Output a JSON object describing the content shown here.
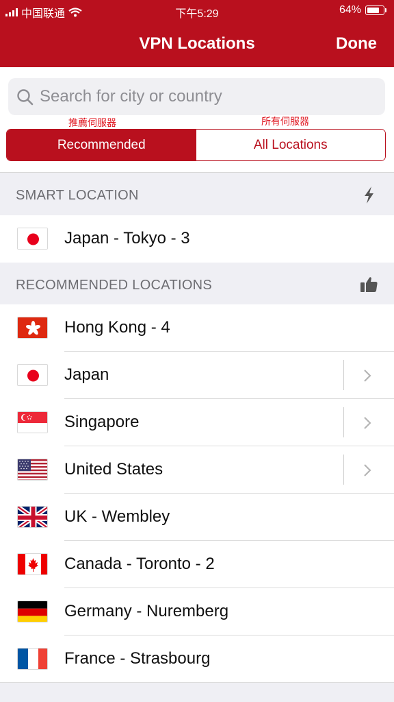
{
  "status_bar": {
    "carrier": "中国联通",
    "time": "下午5:29",
    "battery": "64%",
    "battery_level": 0.64
  },
  "nav": {
    "title": "VPN Locations",
    "done_label": "Done"
  },
  "search": {
    "placeholder": "Search for city or country"
  },
  "annotations": {
    "recommended_servers": "推薦伺服器",
    "all_servers": "所有伺服器"
  },
  "tabs": [
    {
      "label": "Recommended",
      "selected": true
    },
    {
      "label": "All Locations",
      "selected": false
    }
  ],
  "smart_section": {
    "title": "SMART LOCATION",
    "icon": "lightning-icon",
    "items": [
      {
        "name": "Japan - Tokyo - 3",
        "flag": "japan-flag-icon"
      }
    ]
  },
  "recommended_section": {
    "title": "RECOMMENDED LOCATIONS",
    "icon": "thumbs-up-icon",
    "items": [
      {
        "name": "Hong Kong - 4",
        "flag": "hong-kong-flag-icon",
        "expandable": false
      },
      {
        "name": "Japan",
        "flag": "japan-flag-icon",
        "expandable": true
      },
      {
        "name": "Singapore",
        "flag": "singapore-flag-icon",
        "expandable": true
      },
      {
        "name": "United States",
        "flag": "usa-flag-icon",
        "expandable": true
      },
      {
        "name": "UK - Wembley",
        "flag": "uk-flag-icon",
        "expandable": false
      },
      {
        "name": "Canada - Toronto - 2",
        "flag": "canada-flag-icon",
        "expandable": false
      },
      {
        "name": "Germany - Nuremberg",
        "flag": "germany-flag-icon",
        "expandable": false
      },
      {
        "name": "France - Strasbourg",
        "flag": "france-flag-icon",
        "expandable": false
      }
    ]
  },
  "colors": {
    "brand_red": "#b9101e",
    "annotation_red": "#e0141e",
    "section_bg": "#efeff4"
  }
}
